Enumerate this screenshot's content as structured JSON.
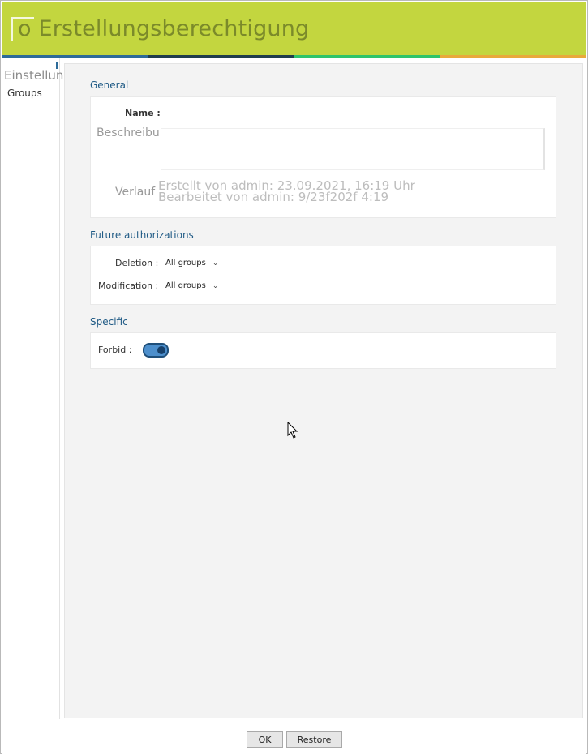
{
  "window": {
    "title": "o Erstellungsberechtigung",
    "colors": {
      "titlebar": "#c3d63f",
      "stripes": [
        "#2d6b99",
        "#1f3d4c",
        "#2ec46a",
        "#e9a93b"
      ]
    }
  },
  "sidebar": {
    "heading": "Einstellungen",
    "items": [
      {
        "label": "Groups"
      }
    ]
  },
  "general": {
    "section_title": "General",
    "name_label": "Name :",
    "name_value": "",
    "description_label": "Beschreibung:",
    "description_value": "",
    "history_label": "Verlauf",
    "created_text": "Erstellt von admin: 23.09.2021, 16:19 Uhr",
    "edited_text": "Bearbeitet von admin: 9/23f202f 4:19"
  },
  "future": {
    "section_title": "Future authorizations",
    "deletion_label": "Deletion :",
    "deletion_value": "All groups",
    "modification_label": "Modification :",
    "modification_value": "All groups"
  },
  "specific": {
    "section_title": "Specific",
    "forbid_label": "Forbid :",
    "forbid_on": true
  },
  "footer": {
    "ok_label": "OK",
    "restore_label": "Restore"
  },
  "icons": {
    "window": "window-icon",
    "dropdown": "chevron-down-icon",
    "pointer": "mouse-pointer-icon"
  }
}
